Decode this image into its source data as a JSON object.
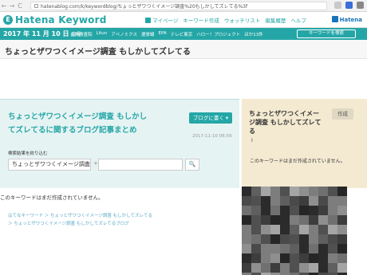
{
  "browser": {
    "back": "←",
    "forward": "→",
    "reload": "C",
    "url": "hatenablog.com/k/keywordblog/ちょっとザワつくイメージ調査%20もしかしてズレてる%3f"
  },
  "header": {
    "logo_mark": "E",
    "logo_text": "Hatena Keyword",
    "nav": [
      "マイページ",
      "キーワード作成",
      "ウォッチリスト",
      "編集履歴",
      "ヘルプ"
    ],
    "brand": "Hatena"
  },
  "date_bar": {
    "date": "2017 年 11 月 10 日",
    "weekday": "金曜",
    "trends": [
      "会計検査院",
      "Litun",
      "アベノミクス",
      "選挙線",
      "EPA",
      "テレビ東京",
      "ハロー！プロジェクト",
      "ほか13件"
    ],
    "search_button": "キーワードを検索"
  },
  "page_title": "ちょっとザワつくイメージ調査 もしかしてズレてる",
  "main": {
    "heading": "ちょっとザワつくイメージ調査 もしかしてズレてるに関するブログ記事まとめ",
    "write_button": "ブログに書く ▾",
    "date": "2017-11-10 06:59",
    "filter_label": "検索結果を絞り込む",
    "keyword_value": "ちょっとザワつくイメージ調査 もしかしてズレてる",
    "plus": "+",
    "search_icon": "🔍",
    "no_description": "このキーワードはまだ作成されていません。"
  },
  "breadcrumbs": {
    "line1": "はてなキーワード ＞ ちょっとザワつくイメージ調査 もしかしてズレてる",
    "line2": "＞ ちょっとザワつくイメージ調査 もしかしてズレてるブログ"
  },
  "side": {
    "title": "ちょっとザワつくイメージ調査 もしかしてズレてる",
    "create_button": "作成",
    "cursor": "I",
    "no_description": "このキーワードはまだ作成されていません。"
  },
  "colors": {
    "accent": "#25a6a6",
    "side_bg": "#f4ead2",
    "main_bg": "#e6f3f3"
  }
}
